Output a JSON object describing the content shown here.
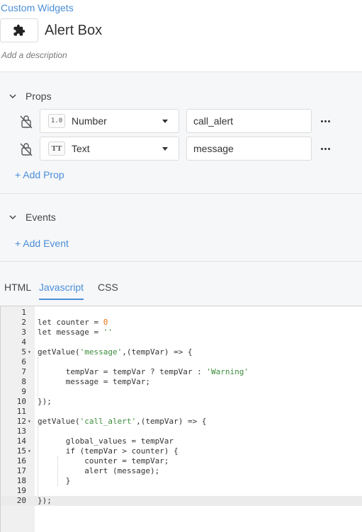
{
  "breadcrumb": "Custom Widgets",
  "widget": {
    "title": "Alert Box",
    "icon": "puzzle-icon",
    "description_placeholder": "Add a description"
  },
  "props_section": {
    "label": "Props",
    "rows": [
      {
        "type_badge": "1.0",
        "type_label": "Number",
        "name": "call_alert"
      },
      {
        "type_badge": "TT",
        "type_label": "Text",
        "name": "message"
      }
    ],
    "add_label": "+ Add Prop"
  },
  "events_section": {
    "label": "Events",
    "add_label": "+ Add Event"
  },
  "tabs": [
    "HTML",
    "Javascript",
    "CSS"
  ],
  "active_tab": "Javascript",
  "editor": {
    "active_line": 20,
    "lines": [
      "",
      "let counter = 0",
      "let message = ''",
      "",
      "getValue('message',(tempVar) => {",
      "",
      "      tempVar = tempVar ? tempVar : 'Warning'",
      "      message = tempVar;",
      "",
      "});",
      "",
      "getValue('call_alert',(tempVar) => {",
      "",
      "      global_values = tempVar",
      "      if (tempVar > counter) {",
      "          counter = tempVar;",
      "          alert (message);",
      "      }",
      "",
      "});"
    ]
  },
  "colors": {
    "link": "#4a8ed8",
    "number_literal": "#e8730c",
    "string_literal": "#3b8c3b"
  }
}
